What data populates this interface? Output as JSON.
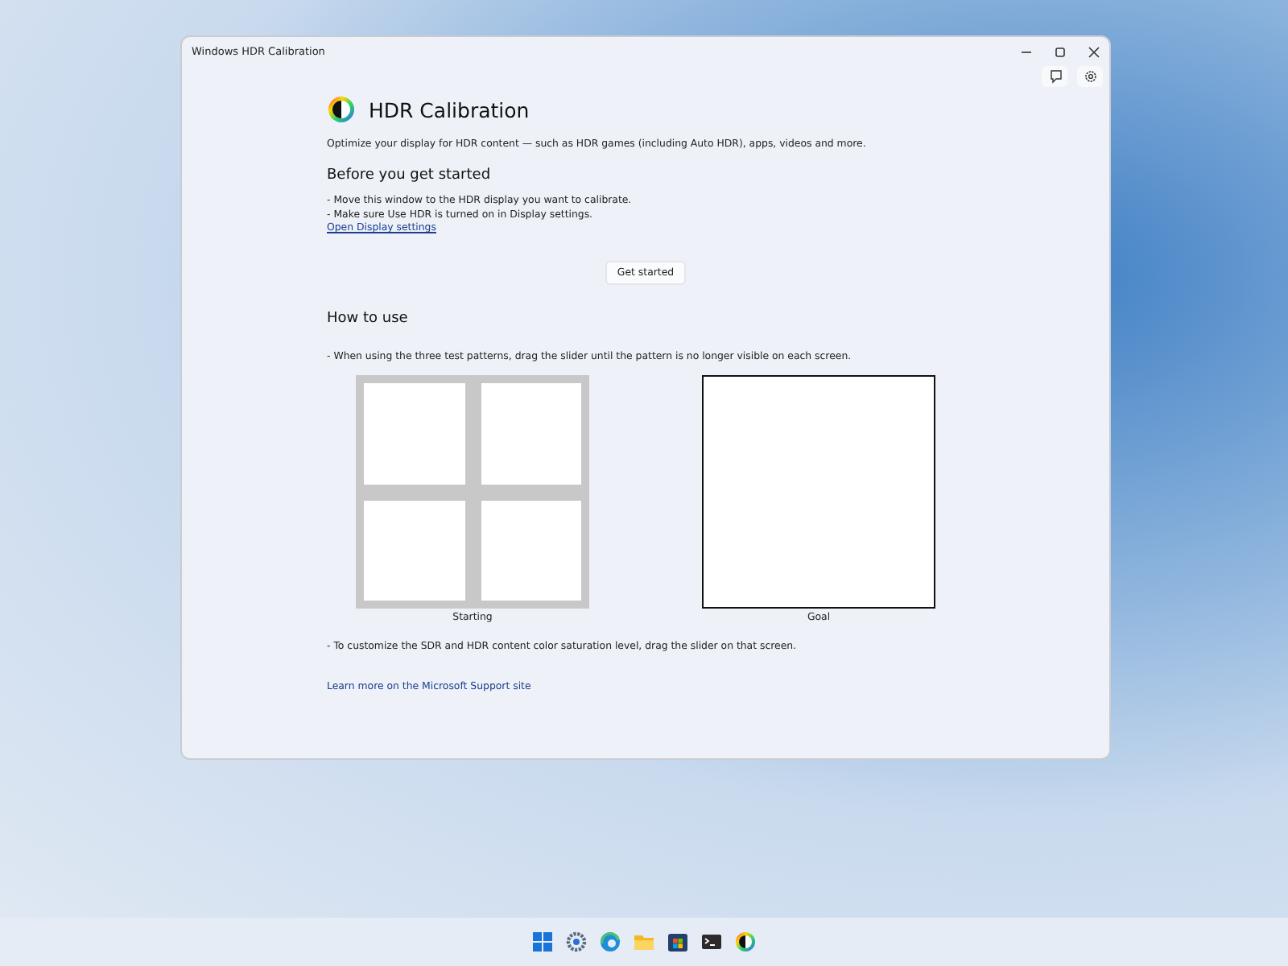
{
  "window": {
    "title": "Windows HDR Calibration"
  },
  "app_title": "HDR Calibration",
  "intro": "Optimize your display for HDR content — such as HDR games (including Auto HDR), apps, videos and more.",
  "before": {
    "heading": "Before you get started",
    "bullets": [
      "- Move this window to the HDR display you want to calibrate.",
      "- Make sure Use HDR is turned on in Display settings."
    ],
    "link": "Open Display settings"
  },
  "button": "Get started",
  "how": {
    "heading": "How to use",
    "bullet": "- When using the three test patterns, drag the slider until the pattern is no longer visible on each screen.",
    "patterns": [
      {
        "kind": "grid",
        "label": "Starting"
      },
      {
        "kind": "blank",
        "label": "Goal"
      }
    ],
    "bullet2": "- To customize the SDR and HDR content color saturation level, drag the slider on that screen."
  },
  "link": "Learn more on the Microsoft Support site"
}
